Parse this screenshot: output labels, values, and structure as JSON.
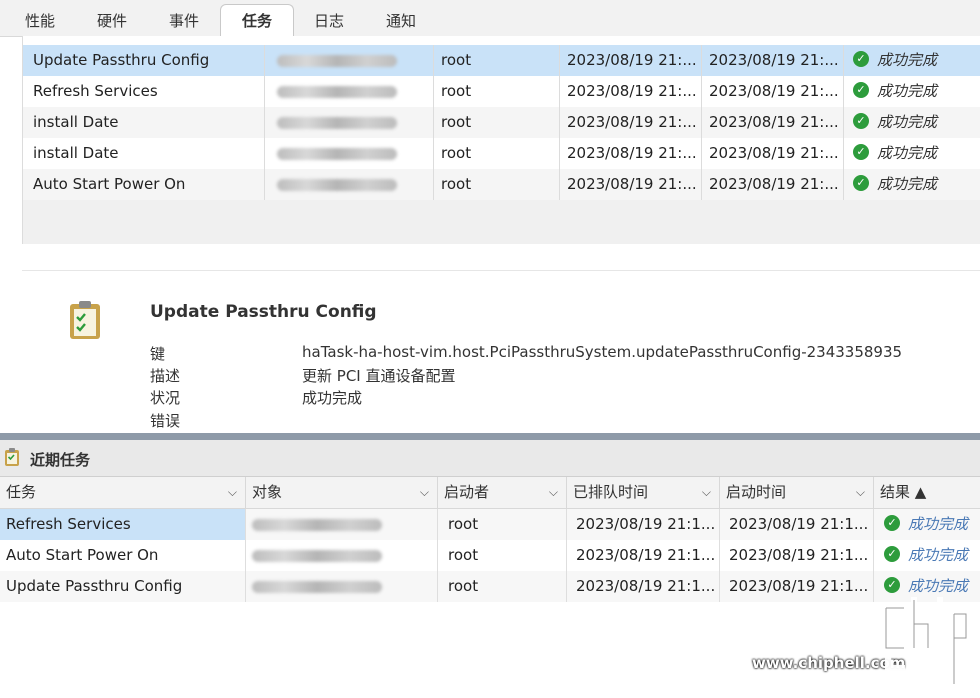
{
  "tabs": [
    {
      "label": "性能",
      "active": false
    },
    {
      "label": "硬件",
      "active": false
    },
    {
      "label": "事件",
      "active": false
    },
    {
      "label": "任务",
      "active": true
    },
    {
      "label": "日志",
      "active": false
    },
    {
      "label": "通知",
      "active": false
    }
  ],
  "top_grid": {
    "rows": [
      {
        "task": "Update Passthru Config",
        "initiator": "root",
        "queued": "2023/08/19 21:...",
        "started": "2023/08/19 21:...",
        "result": "成功完成",
        "selected": true
      },
      {
        "task": "Refresh Services",
        "initiator": "root",
        "queued": "2023/08/19 21:...",
        "started": "2023/08/19 21:...",
        "result": "成功完成",
        "selected": false
      },
      {
        "task": "install Date",
        "initiator": "root",
        "queued": "2023/08/19 21:...",
        "started": "2023/08/19 21:...",
        "result": "成功完成",
        "selected": false
      },
      {
        "task": "install Date",
        "initiator": "root",
        "queued": "2023/08/19 21:...",
        "started": "2023/08/19 21:...",
        "result": "成功完成",
        "selected": false
      },
      {
        "task": "Auto Start Power On",
        "initiator": "root",
        "queued": "2023/08/19 21:...",
        "started": "2023/08/19 21:...",
        "result": "成功完成",
        "selected": false
      }
    ]
  },
  "detail": {
    "title": "Update Passthru Config",
    "fields": [
      {
        "label": "键",
        "value": "haTask-ha-host-vim.host.PciPassthruSystem.updatePassthruConfig-2343358935"
      },
      {
        "label": "描述",
        "value": "更新 PCI 直通设备配置"
      },
      {
        "label": "状况",
        "value": "成功完成"
      },
      {
        "label": "错误",
        "value": ""
      }
    ]
  },
  "recent": {
    "title": "近期任务",
    "columns": [
      "任务",
      "对象",
      "启动者",
      "已排队时间",
      "启动时间",
      "结果 ▲"
    ],
    "rows": [
      {
        "task": "Refresh Services",
        "initiator": "root",
        "queued": "2023/08/19 21:1...",
        "started": "2023/08/19 21:1...",
        "result": "成功完成"
      },
      {
        "task": "Auto Start Power On",
        "initiator": "root",
        "queued": "2023/08/19 21:1...",
        "started": "2023/08/19 21:1...",
        "result": "成功完成"
      },
      {
        "task": "Update Passthru Config",
        "initiator": "root",
        "queued": "2023/08/19 21:1...",
        "started": "2023/08/19 21:1...",
        "result": "成功完成"
      }
    ]
  },
  "watermark": {
    "url": "www.chiphell.com"
  },
  "colors": {
    "selected_row": "#c9e2f8",
    "success_green": "#2d9c3c",
    "link_blue": "#4a79b5"
  }
}
